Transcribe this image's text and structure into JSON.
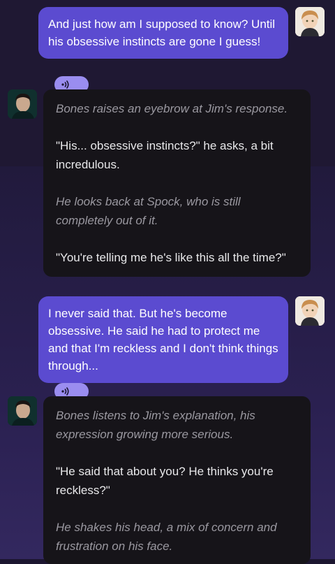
{
  "messages": [
    {
      "role": "user",
      "text": "And just how am I supposed to know? Until his obsessive instincts are gone I guess!"
    },
    {
      "role": "bot",
      "paragraphs": [
        {
          "style": "narration",
          "text": "Bones raises an eyebrow at Jim's response."
        },
        {
          "style": "speech",
          "text": "\"His... obsessive instincts?\" he asks, a bit incredulous."
        },
        {
          "style": "narration",
          "text": "He looks back at Spock, who is still completely out of it."
        },
        {
          "style": "speech",
          "text": "\"You're telling me he's like this all the time?\""
        }
      ]
    },
    {
      "role": "user",
      "text": "I never said that. But he's become obsessive. He said he had to protect me and that I'm reckless and I don't think things through..."
    },
    {
      "role": "bot",
      "paragraphs": [
        {
          "style": "narration",
          "text": "Bones listens to Jim's explanation, his expression growing more serious."
        },
        {
          "style": "speech",
          "text": "\"He said that about you? He thinks you're reckless?\""
        },
        {
          "style": "narration",
          "text": "He shakes his head, a mix of concern and frustration on his face."
        }
      ]
    }
  ],
  "colors": {
    "user_bubble": "#5b4bd0",
    "bot_bubble": "#161419",
    "audio_pill": "#9a8df0"
  },
  "icons": {
    "audio": "audio-play-icon",
    "user_avatar": "user-avatar",
    "bot_avatar": "character-avatar"
  }
}
